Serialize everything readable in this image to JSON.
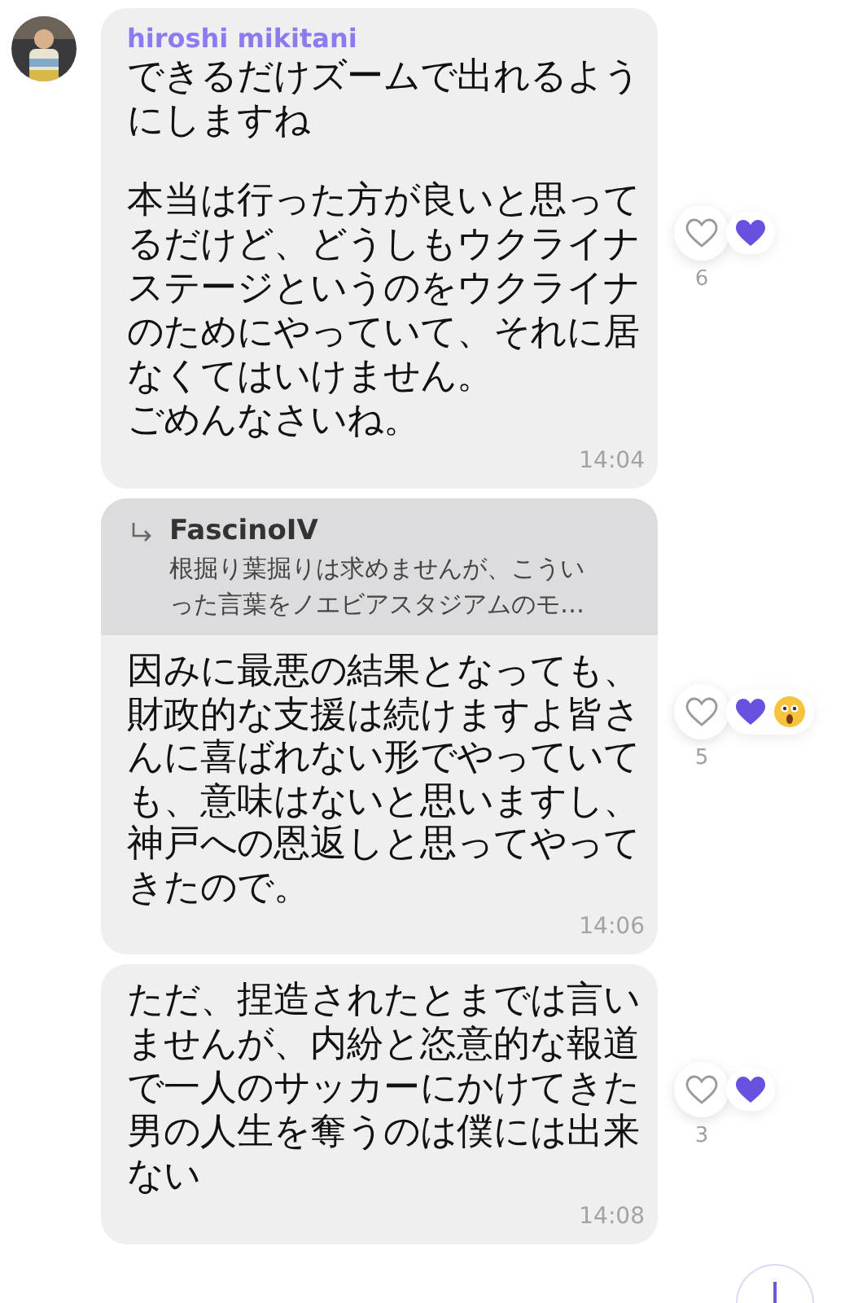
{
  "messages": [
    {
      "sender": "hiroshi mikitani",
      "paragraphs": [
        [
          "できるだけズームで出れるようにしますね"
        ],
        [
          "本当は行った方が良いと思ってるだけど、どうしもウクライナステージというのをウクライナのためにやっていて、それに居なくてはいけません。",
          "ごめんなさいね。"
        ]
      ],
      "time": "14:04",
      "reactions": [
        {
          "kind": "purple_heart"
        }
      ],
      "count": "6"
    },
    {
      "reply": {
        "author": "FascinoIV",
        "text": "根掘り葉掘りは求めませんが、こういった言葉をノエビアスタジアムのモ…"
      },
      "paragraphs": [
        [
          "因みに最悪の結果となっても、財政的な支援は続けますよ皆さんに喜ばれない形でやっていても、意味はないと思いますし、神戸への恩返しと思ってやってきたので。"
        ]
      ],
      "time": "14:06",
      "reactions": [
        {
          "kind": "purple_heart"
        },
        {
          "kind": "surprised"
        }
      ],
      "count": "5"
    },
    {
      "paragraphs": [
        [
          "ただ、捏造されたとまでは言いませんが、内紛と恣意的な報道で一人のサッカーにかけてきた男の人生を奪うのは僕には出来ない"
        ]
      ],
      "time": "14:08",
      "reactions": [
        {
          "kind": "purple_heart"
        }
      ],
      "count": "3"
    }
  ]
}
